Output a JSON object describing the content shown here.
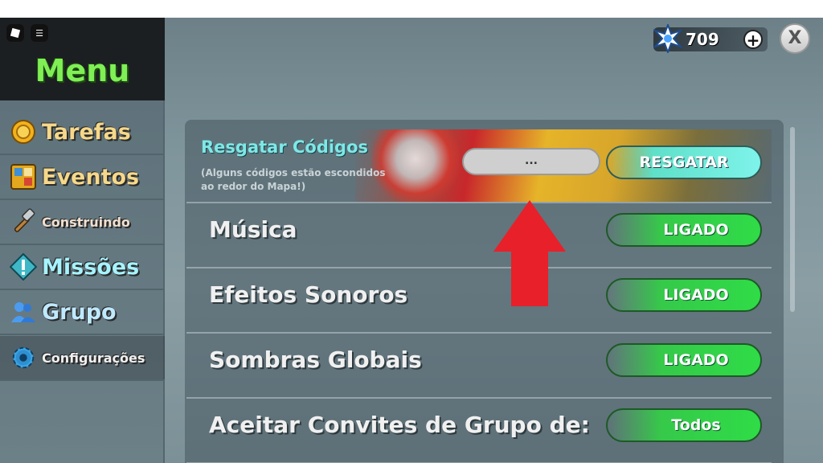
{
  "menu": {
    "title": "Menu",
    "items": [
      {
        "label": "Tarefas",
        "icon": "coin-icon"
      },
      {
        "label": "Eventos",
        "icon": "events-icon"
      },
      {
        "label": "Construindo",
        "icon": "hammer-icon"
      },
      {
        "label": "Missões",
        "icon": "exclamation-icon"
      },
      {
        "label": "Grupo",
        "icon": "group-icon"
      },
      {
        "label": "Configurações",
        "icon": "gear-icon"
      }
    ]
  },
  "header": {
    "currency_value": "709",
    "plus_label": "+",
    "close_label": "X"
  },
  "codes": {
    "title": "Resgatar Códigos",
    "subtitle": "(Alguns códigos estão escondidos ao redor do Mapa!)",
    "input_value": "...",
    "redeem_label": "RESGATAR"
  },
  "settings": [
    {
      "label": "Música",
      "value": "LIGADO"
    },
    {
      "label": "Efeitos Sonoros",
      "value": "LIGADO"
    },
    {
      "label": "Sombras Globais",
      "value": "LIGADO"
    },
    {
      "label": "Aceitar Convites de Grupo de:",
      "value": "Todos"
    }
  ],
  "colors": {
    "menu_title": "#7fef55",
    "toggle_on": "#2fdc47",
    "redeem": "#7ef3ea",
    "arrow": "#e8202a"
  }
}
